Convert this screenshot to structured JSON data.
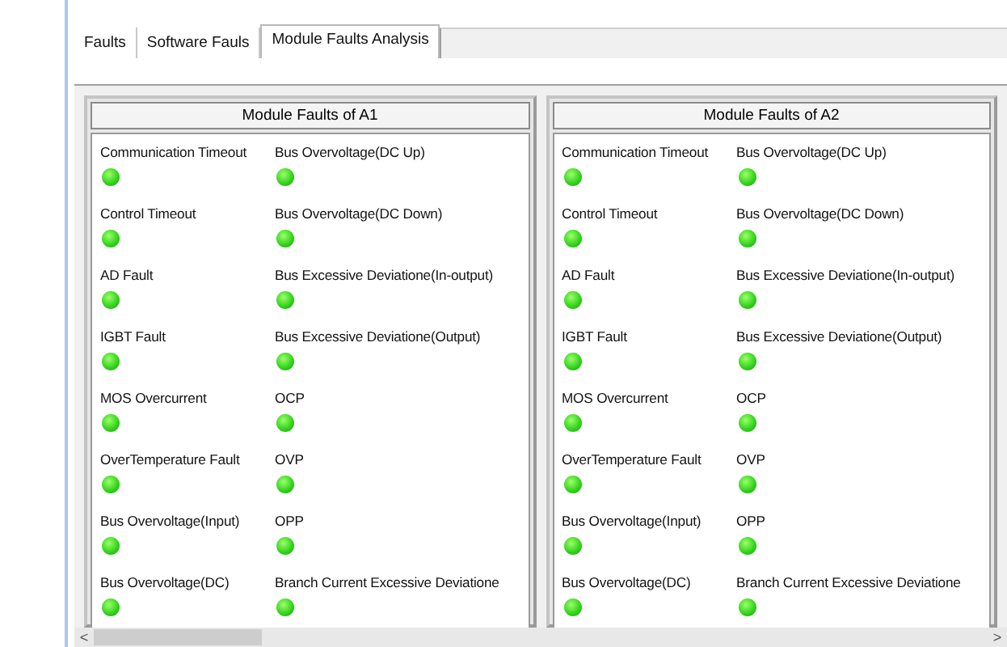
{
  "tabs": [
    {
      "label": "Faults",
      "selected": false
    },
    {
      "label": "Software Fauls",
      "selected": false
    },
    {
      "label": "Module Faults Analysis",
      "selected": true
    }
  ],
  "panels": [
    {
      "title": "Module Faults of A1",
      "faults": [
        {
          "label": "Communication Timeout",
          "fault": false
        },
        {
          "label": "Bus Overvoltage(DC Up)",
          "fault": false
        },
        {
          "label": "Control Timeout",
          "fault": false
        },
        {
          "label": "Bus Overvoltage(DC Down)",
          "fault": false
        },
        {
          "label": "AD Fault",
          "fault": false
        },
        {
          "label": "Bus Excessive Deviatione(In-output)",
          "fault": false
        },
        {
          "label": "IGBT Fault",
          "fault": false
        },
        {
          "label": "Bus Excessive Deviatione(Output)",
          "fault": false
        },
        {
          "label": "MOS Overcurrent",
          "fault": false
        },
        {
          "label": "OCP",
          "fault": false
        },
        {
          "label": "OverTemperature Fault",
          "fault": false
        },
        {
          "label": "OVP",
          "fault": false
        },
        {
          "label": "Bus Overvoltage(Input)",
          "fault": false
        },
        {
          "label": "OPP",
          "fault": false
        },
        {
          "label": "Bus Overvoltage(DC)",
          "fault": false
        },
        {
          "label": "Branch Current Excessive Deviatione",
          "fault": false
        }
      ]
    },
    {
      "title": "Module Faults of A2",
      "faults": [
        {
          "label": "Communication Timeout",
          "fault": false
        },
        {
          "label": "Bus Overvoltage(DC Up)",
          "fault": false
        },
        {
          "label": "Control Timeout",
          "fault": false
        },
        {
          "label": "Bus Overvoltage(DC Down)",
          "fault": false
        },
        {
          "label": "AD Fault",
          "fault": false
        },
        {
          "label": "Bus Excessive Deviatione(In-output)",
          "fault": false
        },
        {
          "label": "IGBT Fault",
          "fault": false
        },
        {
          "label": "Bus Excessive Deviatione(Output)",
          "fault": false
        },
        {
          "label": "MOS Overcurrent",
          "fault": false
        },
        {
          "label": "OCP",
          "fault": false
        },
        {
          "label": "OverTemperature Fault",
          "fault": false
        },
        {
          "label": "OVP",
          "fault": false
        },
        {
          "label": "Bus Overvoltage(Input)",
          "fault": false
        },
        {
          "label": "OPP",
          "fault": false
        },
        {
          "label": "Bus Overvoltage(DC)",
          "fault": false
        },
        {
          "label": "Branch Current Excessive Deviatione",
          "fault": false
        }
      ]
    }
  ],
  "scrollbar": {
    "left": "<",
    "right": ">"
  }
}
